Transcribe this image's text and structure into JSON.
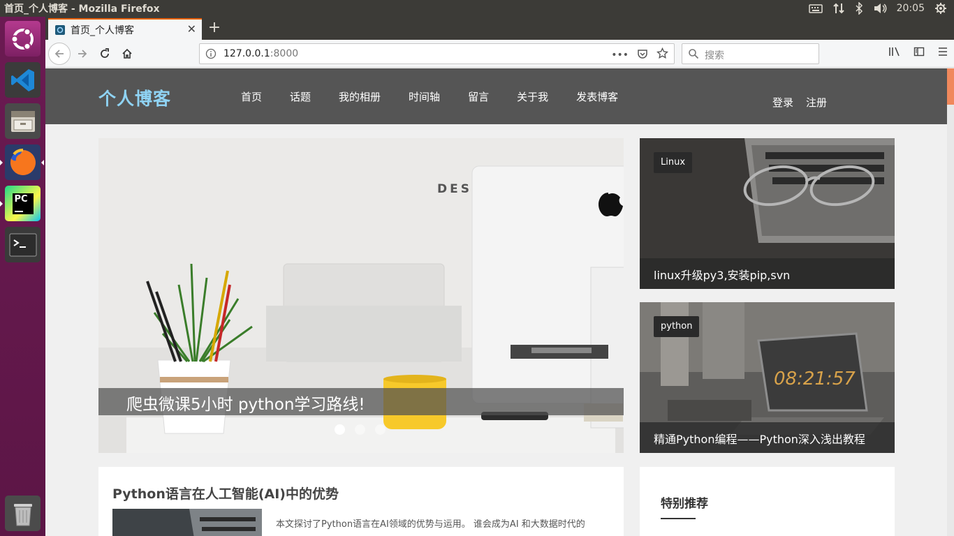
{
  "system": {
    "window_title": "首页_个人博客 - Mozilla Firefox",
    "clock": "20:05"
  },
  "launcher": {
    "items": [
      "ubuntu-dash",
      "vscode",
      "file-manager",
      "firefox",
      "pycharm",
      "terminal",
      "trash"
    ],
    "pycharm_label": "PC"
  },
  "browser": {
    "tab_title": "首页_个人博客",
    "url_host": "127.0.0.1",
    "url_port": ":8000",
    "search_placeholder": "搜索",
    "url_more": "•••"
  },
  "site": {
    "logo": "个人博客",
    "nav": [
      "首页",
      "话题",
      "我的相册",
      "时间轴",
      "留言",
      "关于我",
      "发表博客"
    ],
    "login": "登录",
    "register": "注册"
  },
  "banner": {
    "caption": "爬虫微课5小时 python学习路线!",
    "active_slide": 1,
    "slide_count": 3,
    "ghost_text": "DES"
  },
  "side_cards": [
    {
      "tag": "Linux",
      "title": "linux升级py3,安装pip,svn"
    },
    {
      "tag": "python",
      "title": "精通Python编程——Python深入浅出教程",
      "clock_text": "08:21:57"
    }
  ],
  "article": {
    "title": "Python语言在人工智能(AI)中的优势",
    "summary": "本文探讨了Python语言在AI领域的优势与运用。 谁会成为AI 和大数据时代的"
  },
  "recommend": {
    "title": "特别推荐"
  }
}
